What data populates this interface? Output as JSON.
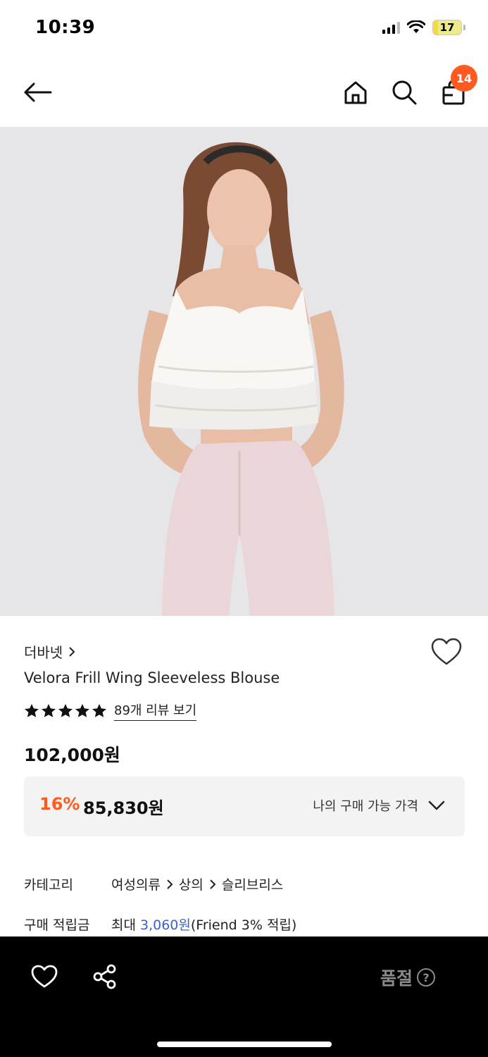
{
  "status": {
    "time": "10:39",
    "battery": "17"
  },
  "nav": {
    "cart_count": "14"
  },
  "product": {
    "brand": "더바넷",
    "title": "Velora Frill Wing Sleeveless Blouse",
    "review_link": "89개 리뷰 보기",
    "rating_stars": 5,
    "price": "102,000원",
    "discount_rate": "16%",
    "discount_price": "85,830원",
    "my_price_label": "나의 구매 가능 가격"
  },
  "info": {
    "category_label": "카테고리",
    "category_path": [
      "여성의류",
      "상의",
      "슬리브리스"
    ],
    "points_label": "구매 적립금",
    "points_prefix": "최대 ",
    "points_amount": "3,060원",
    "points_suffix": "(Friend 3% 적립)"
  },
  "bottom_bar": {
    "soldout_label": "품절",
    "help_glyph": "?"
  },
  "colors": {
    "accent": "#ff5a1f",
    "link_blue": "#3c5fd6",
    "bottom_bar_bg": "#000000"
  }
}
